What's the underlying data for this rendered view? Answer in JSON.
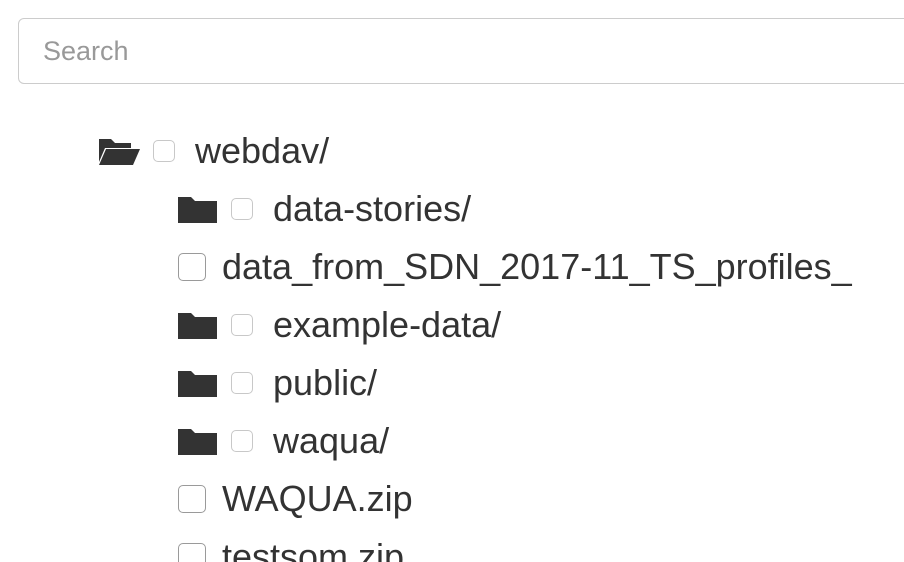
{
  "search": {
    "placeholder": "Search",
    "value": ""
  },
  "tree": {
    "root": {
      "label": "webdav/",
      "icon": "folder-open-icon",
      "expanded": true
    },
    "children": [
      {
        "label": "data-stories/",
        "type": "folder",
        "icon": "folder-icon"
      },
      {
        "label": "data_from_SDN_2017-11_TS_profiles_",
        "type": "file"
      },
      {
        "label": "example-data/",
        "type": "folder",
        "icon": "folder-icon"
      },
      {
        "label": "public/",
        "type": "folder",
        "icon": "folder-icon"
      },
      {
        "label": "waqua/",
        "type": "folder",
        "icon": "folder-icon"
      },
      {
        "label": "WAQUA.zip",
        "type": "file"
      },
      {
        "label": "testsom.zip",
        "type": "file"
      }
    ]
  },
  "colors": {
    "text": "#333333",
    "icon": "#333333",
    "placeholder": "#999999",
    "border": "#cccccc"
  }
}
